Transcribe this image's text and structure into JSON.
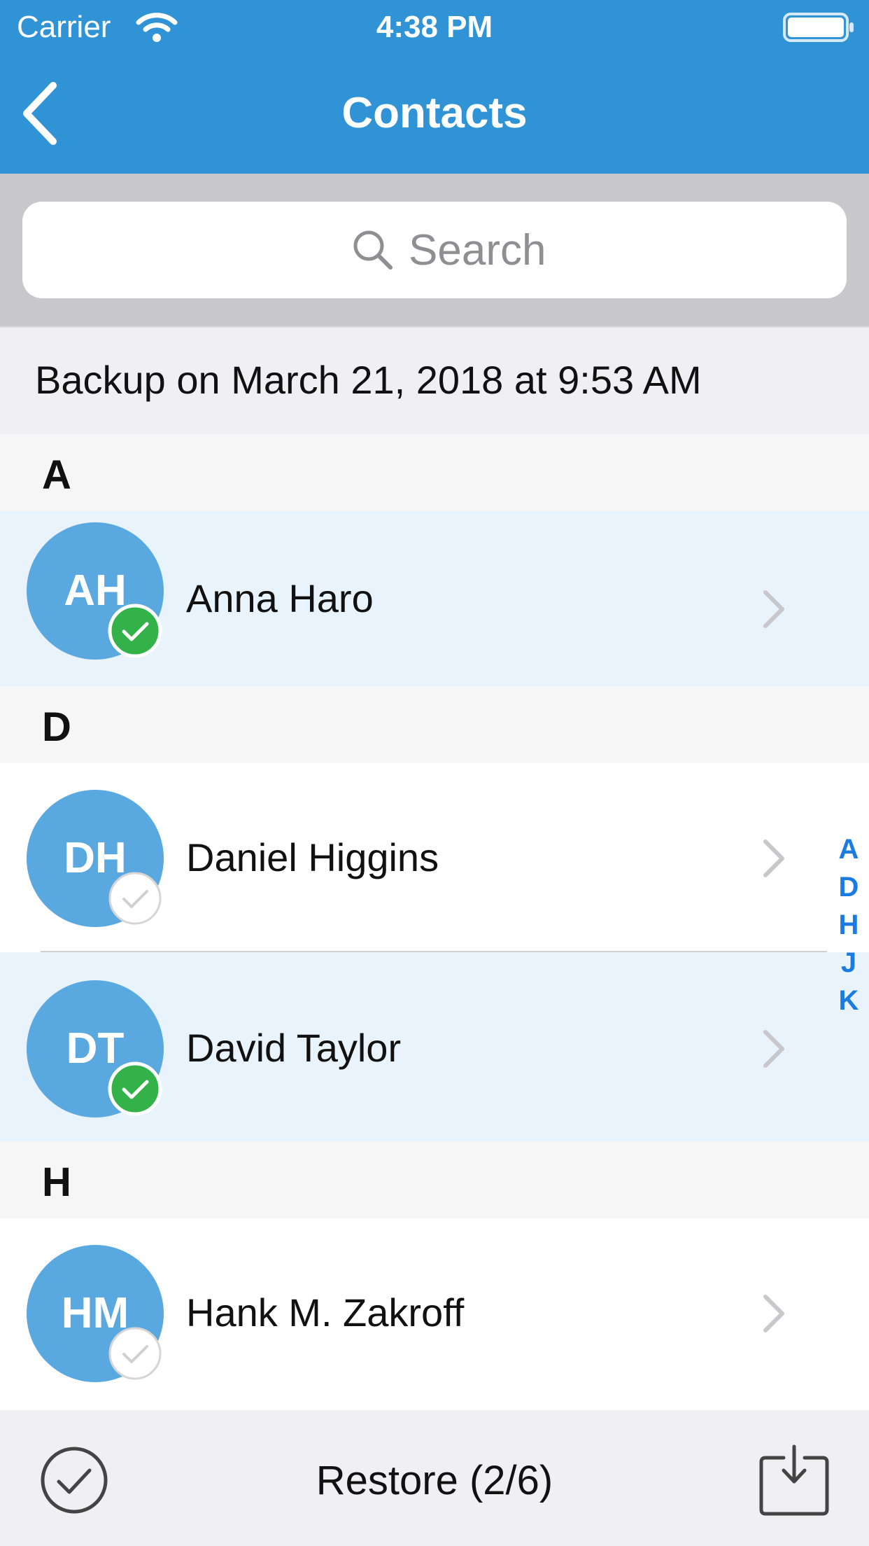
{
  "status_bar": {
    "carrier": "Carrier",
    "time": "4:38 PM"
  },
  "nav": {
    "title": "Contacts"
  },
  "search": {
    "placeholder": "Search"
  },
  "backup_label": "Backup on March 21, 2018 at 9:53 AM",
  "sections": [
    {
      "letter": "A",
      "contacts": [
        {
          "initials": "AH",
          "name": "Anna Haro",
          "selected": true
        }
      ]
    },
    {
      "letter": "D",
      "contacts": [
        {
          "initials": "DH",
          "name": "Daniel Higgins",
          "selected": false
        },
        {
          "initials": "DT",
          "name": "David Taylor",
          "selected": true
        }
      ]
    },
    {
      "letter": "H",
      "contacts": [
        {
          "initials": "HM",
          "name": "Hank M. Zakroff",
          "selected": false
        }
      ]
    }
  ],
  "index_letters": [
    "A",
    "D",
    "H",
    "J",
    "K"
  ],
  "toolbar": {
    "restore_label": "Restore (2/6)"
  },
  "colors": {
    "header_blue": "#2f93d6",
    "avatar_blue": "#5aa8e0",
    "selected_row": "#e9f3fb",
    "check_green": "#34b24a",
    "index_blue": "#1a7be0"
  }
}
